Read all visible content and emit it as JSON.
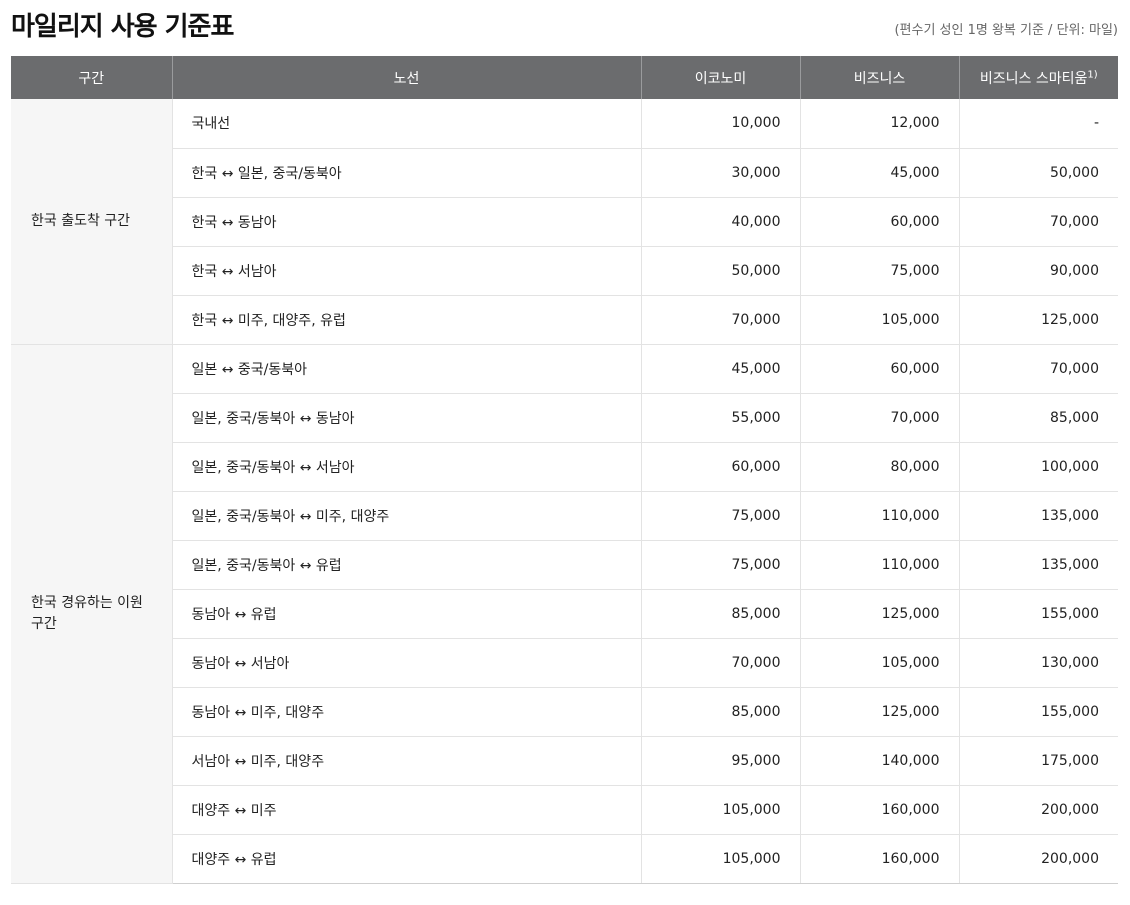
{
  "title": "마일리지 사용 기준표",
  "note": "(편수기 성인 1명 왕복 기준 / 단위: 마일)",
  "headers": {
    "section": "구간",
    "route": "노선",
    "economy": "이코노미",
    "business": "비즈니스",
    "smartium": "비즈니스 스마티움",
    "smartium_note": "1)"
  },
  "sections": [
    {
      "label": "한국 출도착 구간",
      "rows": [
        {
          "route": "국내선",
          "economy": "10,000",
          "business": "12,000",
          "smartium": "-"
        },
        {
          "route": "한국 ↔ 일본, 중국/동북아",
          "economy": "30,000",
          "business": "45,000",
          "smartium": "50,000"
        },
        {
          "route": "한국 ↔ 동남아",
          "economy": "40,000",
          "business": "60,000",
          "smartium": "70,000"
        },
        {
          "route": "한국 ↔ 서남아",
          "economy": "50,000",
          "business": "75,000",
          "smartium": "90,000"
        },
        {
          "route": "한국 ↔ 미주, 대양주, 유럽",
          "economy": "70,000",
          "business": "105,000",
          "smartium": "125,000"
        }
      ]
    },
    {
      "label": "한국 경유하는 이원구간",
      "rows": [
        {
          "route": "일본 ↔ 중국/동북아",
          "economy": "45,000",
          "business": "60,000",
          "smartium": "70,000"
        },
        {
          "route": "일본, 중국/동북아 ↔ 동남아",
          "economy": "55,000",
          "business": "70,000",
          "smartium": "85,000"
        },
        {
          "route": "일본, 중국/동북아 ↔ 서남아",
          "economy": "60,000",
          "business": "80,000",
          "smartium": "100,000"
        },
        {
          "route": "일본, 중국/동북아 ↔ 미주, 대양주",
          "economy": "75,000",
          "business": "110,000",
          "smartium": "135,000"
        },
        {
          "route": "일본, 중국/동북아 ↔ 유럽",
          "economy": "75,000",
          "business": "110,000",
          "smartium": "135,000"
        },
        {
          "route": "동남아 ↔ 유럽",
          "economy": "85,000",
          "business": "125,000",
          "smartium": "155,000"
        },
        {
          "route": "동남아 ↔ 서남아",
          "economy": "70,000",
          "business": "105,000",
          "smartium": "130,000"
        },
        {
          "route": "동남아 ↔ 미주, 대양주",
          "economy": "85,000",
          "business": "125,000",
          "smartium": "155,000"
        },
        {
          "route": "서남아 ↔ 미주, 대양주",
          "economy": "95,000",
          "business": "140,000",
          "smartium": "175,000"
        },
        {
          "route": "대양주 ↔ 미주",
          "economy": "105,000",
          "business": "160,000",
          "smartium": "200,000"
        },
        {
          "route": "대양주 ↔ 유럽",
          "economy": "105,000",
          "business": "160,000",
          "smartium": "200,000"
        }
      ]
    }
  ]
}
